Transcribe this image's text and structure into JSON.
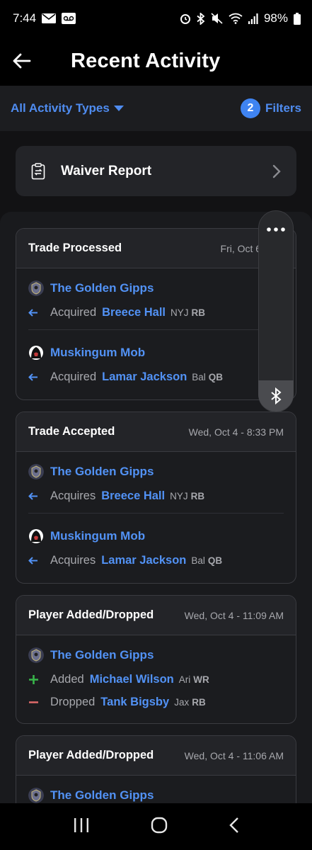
{
  "status_bar": {
    "time": "7:44",
    "battery": "98%"
  },
  "header": {
    "title": "Recent Activity"
  },
  "filter_bar": {
    "activity_type": "All Activity Types",
    "filter_count": "2",
    "filters_label": "Filters"
  },
  "waiver": {
    "label": "Waiver Report"
  },
  "cards": [
    {
      "title": "Trade Processed",
      "date": "Fri, Oct 6 - 8:2",
      "groups": [
        {
          "team": "The Golden Gipps",
          "verb": "Acquired",
          "player": "Breece Hall",
          "team_abbr": "NYJ",
          "pos": "RB"
        },
        {
          "team": "Muskingum Mob",
          "verb": "Acquired",
          "player": "Lamar Jackson",
          "team_abbr": "Bal",
          "pos": "QB"
        }
      ]
    },
    {
      "title": "Trade Accepted",
      "date": "Wed, Oct 4 - 8:33 PM",
      "groups": [
        {
          "team": "The Golden Gipps",
          "verb": "Acquires",
          "player": "Breece Hall",
          "team_abbr": "NYJ",
          "pos": "RB"
        },
        {
          "team": "Muskingum Mob",
          "verb": "Acquires",
          "player": "Lamar Jackson",
          "team_abbr": "Bal",
          "pos": "QB"
        }
      ]
    },
    {
      "title": "Player Added/Dropped",
      "date": "Wed, Oct 4 - 11:09 AM",
      "team": "The Golden Gipps",
      "moves": [
        {
          "verb": "Added",
          "player": "Michael Wilson",
          "team_abbr": "Ari",
          "pos": "WR"
        },
        {
          "verb": "Dropped",
          "player": "Tank Bigsby",
          "team_abbr": "Jax",
          "pos": "RB"
        }
      ]
    },
    {
      "title": "Player Added/Dropped",
      "date": "Wed, Oct 4 - 11:06 AM",
      "team": "The Golden Gipps"
    }
  ],
  "colors": {
    "accent": "#4f8cf0",
    "added": "#38b54a",
    "dropped": "#e06a6a"
  }
}
